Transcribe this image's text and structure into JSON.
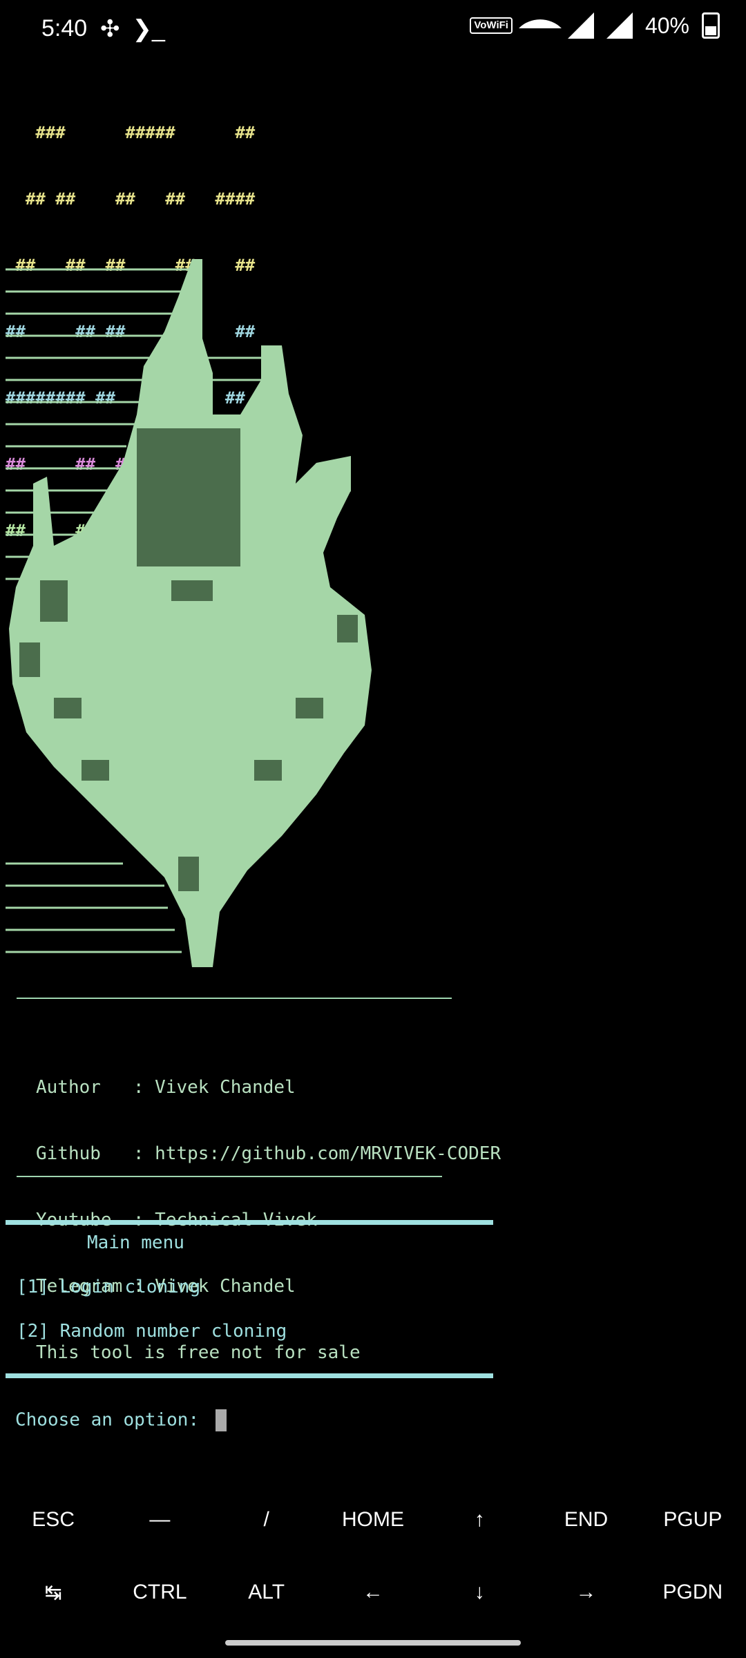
{
  "status": {
    "time": "5:40",
    "battery": "40%",
    "wifi_badge": "VoWiFi"
  },
  "banner": [
    {
      "text": "   ###      #####      ##",
      "color": "yellow"
    },
    {
      "text": "  ## ##    ##   ##   ####",
      "color": "yellow"
    },
    {
      "text": " ##   ##  ##     ##    ##",
      "color": "yellow"
    },
    {
      "text": "##     ## ##     ##    ##",
      "color": "cyan"
    },
    {
      "text": "######## ##     ##    ##",
      "color": "cyan"
    },
    {
      "text": "##     ##  ##   ##     ##",
      "color": "magenta"
    },
    {
      "text": "##     ##   #####    ######",
      "color": "green"
    }
  ],
  "info": {
    "divider_top": "________________________________________",
    "lines": [
      "Author   : Vivek Chandel",
      "Github   : https://github.com/MRVIVEK-CODER",
      "Youtube  : Technical Vivek",
      "Telegram : Vivek Chandel",
      "This tool is free not for sale"
    ]
  },
  "menu": {
    "title": "Main menu",
    "items": [
      "[1] Login cloning",
      "[2] Random number cloning"
    ],
    "prompt": "Choose an option: "
  },
  "keys_row1": [
    "ESC",
    "—",
    "/",
    "HOME",
    "↑",
    "END",
    "PGUP"
  ],
  "keys_row2": [
    "↹",
    "CTRL",
    "ALT",
    "←",
    "↓",
    "→",
    "PGDN"
  ],
  "colors": {
    "green": "#a5d6a7",
    "cyan": "#9fe0e0",
    "yellow": "#e6e28a",
    "magenta": "#d98ad9"
  }
}
